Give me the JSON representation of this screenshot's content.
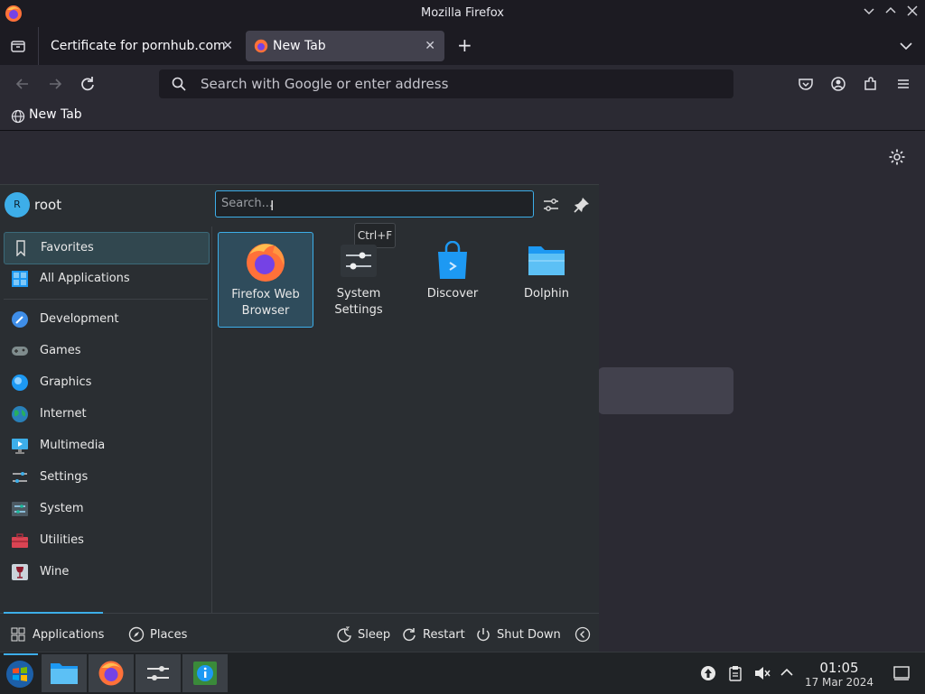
{
  "window": {
    "title": "Mozilla Firefox"
  },
  "tabs": [
    {
      "label": "Certificate for pornhub.com"
    },
    {
      "label": "New Tab"
    }
  ],
  "urlbar": {
    "placeholder": "Search with Google or enter address"
  },
  "bookmarks": [
    {
      "label": "New Tab"
    }
  ],
  "launcher": {
    "user": {
      "initial": "R",
      "name": "root"
    },
    "search": {
      "placeholder": "Search...",
      "tooltip": "Ctrl+F"
    },
    "categories": [
      {
        "label": "Favorites",
        "icon": "bookmark-icon"
      },
      {
        "label": "All Applications",
        "icon": "grid-icon"
      },
      {
        "label": "Development",
        "icon": "development-icon"
      },
      {
        "label": "Games",
        "icon": "gamepad-icon"
      },
      {
        "label": "Graphics",
        "icon": "graphics-icon"
      },
      {
        "label": "Internet",
        "icon": "globe-icon"
      },
      {
        "label": "Multimedia",
        "icon": "multimedia-icon"
      },
      {
        "label": "Settings",
        "icon": "settings-icon"
      },
      {
        "label": "System",
        "icon": "system-icon"
      },
      {
        "label": "Utilities",
        "icon": "toolbox-icon"
      },
      {
        "label": "Wine",
        "icon": "wine-icon"
      }
    ],
    "favorites": [
      {
        "line1": "Firefox Web",
        "line2": "Browser"
      },
      {
        "line1": "System",
        "line2": "Settings"
      },
      {
        "line1": "Discover",
        "line2": ""
      },
      {
        "line1": "Dolphin",
        "line2": ""
      }
    ],
    "footer": {
      "applications": "Applications",
      "places": "Places",
      "sleep": "Sleep",
      "restart": "Restart",
      "shutdown": "Shut Down"
    }
  },
  "clock": {
    "time": "01:05",
    "date": "17 Mar 2024"
  },
  "colors": {
    "accent": "#3daee9",
    "panel": "#2a2e32",
    "browser": "#2b2a33"
  }
}
